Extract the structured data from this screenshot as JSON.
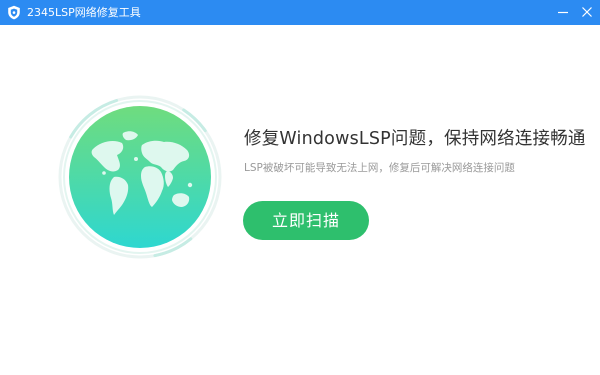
{
  "window": {
    "title": "2345LSP网络修复工具",
    "icon": "shield-icon",
    "minimize_icon": "minimize-icon",
    "close_icon": "close-icon"
  },
  "main": {
    "illustration": "globe-icon",
    "headline": "修复WindowsLSP问题，保持网络连接畅通",
    "subline": "LSP被破坏可能导致无法上网，修复后可解决网络连接问题",
    "scan_button": "立即扫描"
  },
  "colors": {
    "titlebar": "#2c8bf2",
    "button": "#2ebf6d",
    "globe_top": "#6fdc7e",
    "globe_bottom": "#2ed7d0"
  }
}
